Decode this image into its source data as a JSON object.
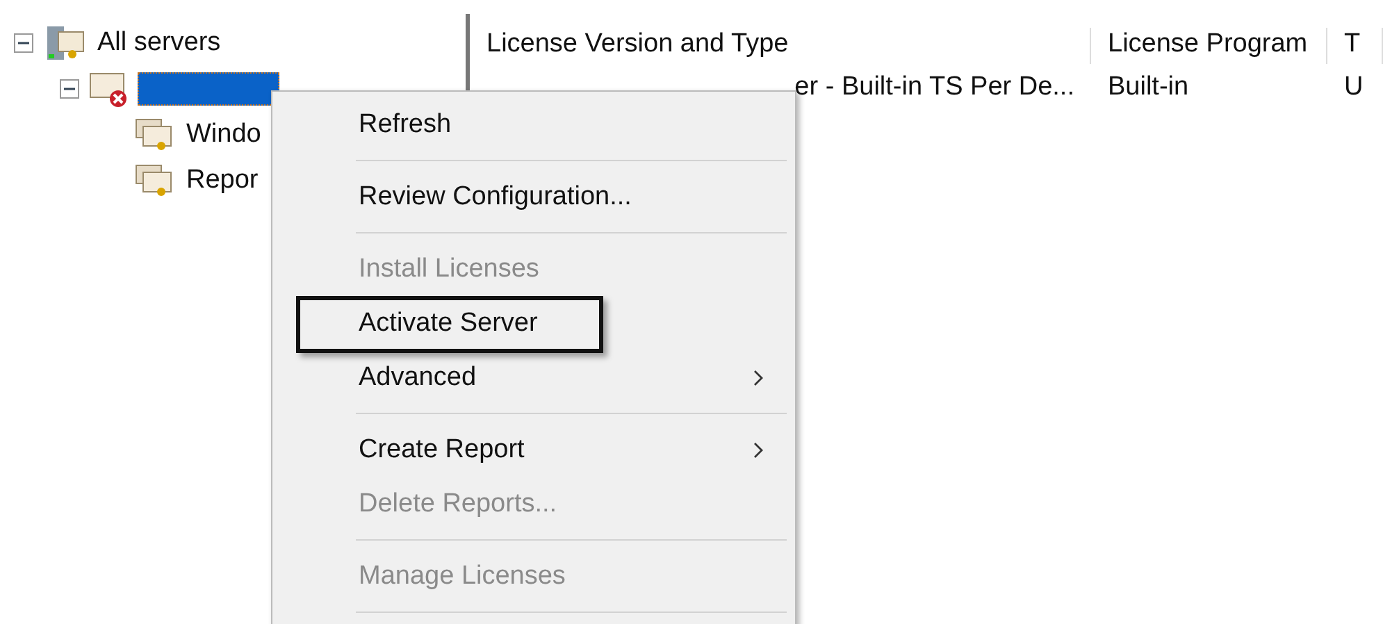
{
  "tree": [
    {
      "label": "All servers",
      "kind": "root",
      "expanded": true,
      "children": [
        {
          "kind": "server",
          "expanded": true,
          "selected": true,
          "error": true,
          "children": [
            {
              "label": "Windo",
              "kind": "folder"
            },
            {
              "label": "Repor",
              "kind": "folder"
            }
          ]
        }
      ]
    }
  ],
  "table": {
    "columns": [
      "License Version and Type",
      "License Program",
      "T"
    ],
    "rows": [
      [
        "er - Built-in TS Per De...",
        "Built-in",
        "U"
      ]
    ]
  },
  "context_menu": [
    {
      "kind": "item",
      "label": "Refresh",
      "disabled": false,
      "submenu": false,
      "highlighted": false
    },
    {
      "kind": "separator"
    },
    {
      "kind": "item",
      "label": "Review Configuration...",
      "disabled": false,
      "submenu": false,
      "highlighted": false
    },
    {
      "kind": "separator"
    },
    {
      "kind": "item",
      "label": "Install Licenses",
      "disabled": true,
      "submenu": false,
      "highlighted": false
    },
    {
      "kind": "item",
      "label": "Activate Server",
      "disabled": false,
      "submenu": false,
      "highlighted": true
    },
    {
      "kind": "item",
      "label": "Advanced",
      "disabled": false,
      "submenu": true,
      "highlighted": false
    },
    {
      "kind": "separator"
    },
    {
      "kind": "item",
      "label": "Create Report",
      "disabled": false,
      "submenu": true,
      "highlighted": false
    },
    {
      "kind": "item",
      "label": "Delete Reports...",
      "disabled": true,
      "submenu": false,
      "highlighted": false
    },
    {
      "kind": "separator"
    },
    {
      "kind": "item",
      "label": "Manage Licenses",
      "disabled": true,
      "submenu": false,
      "highlighted": false
    },
    {
      "kind": "separator"
    }
  ]
}
